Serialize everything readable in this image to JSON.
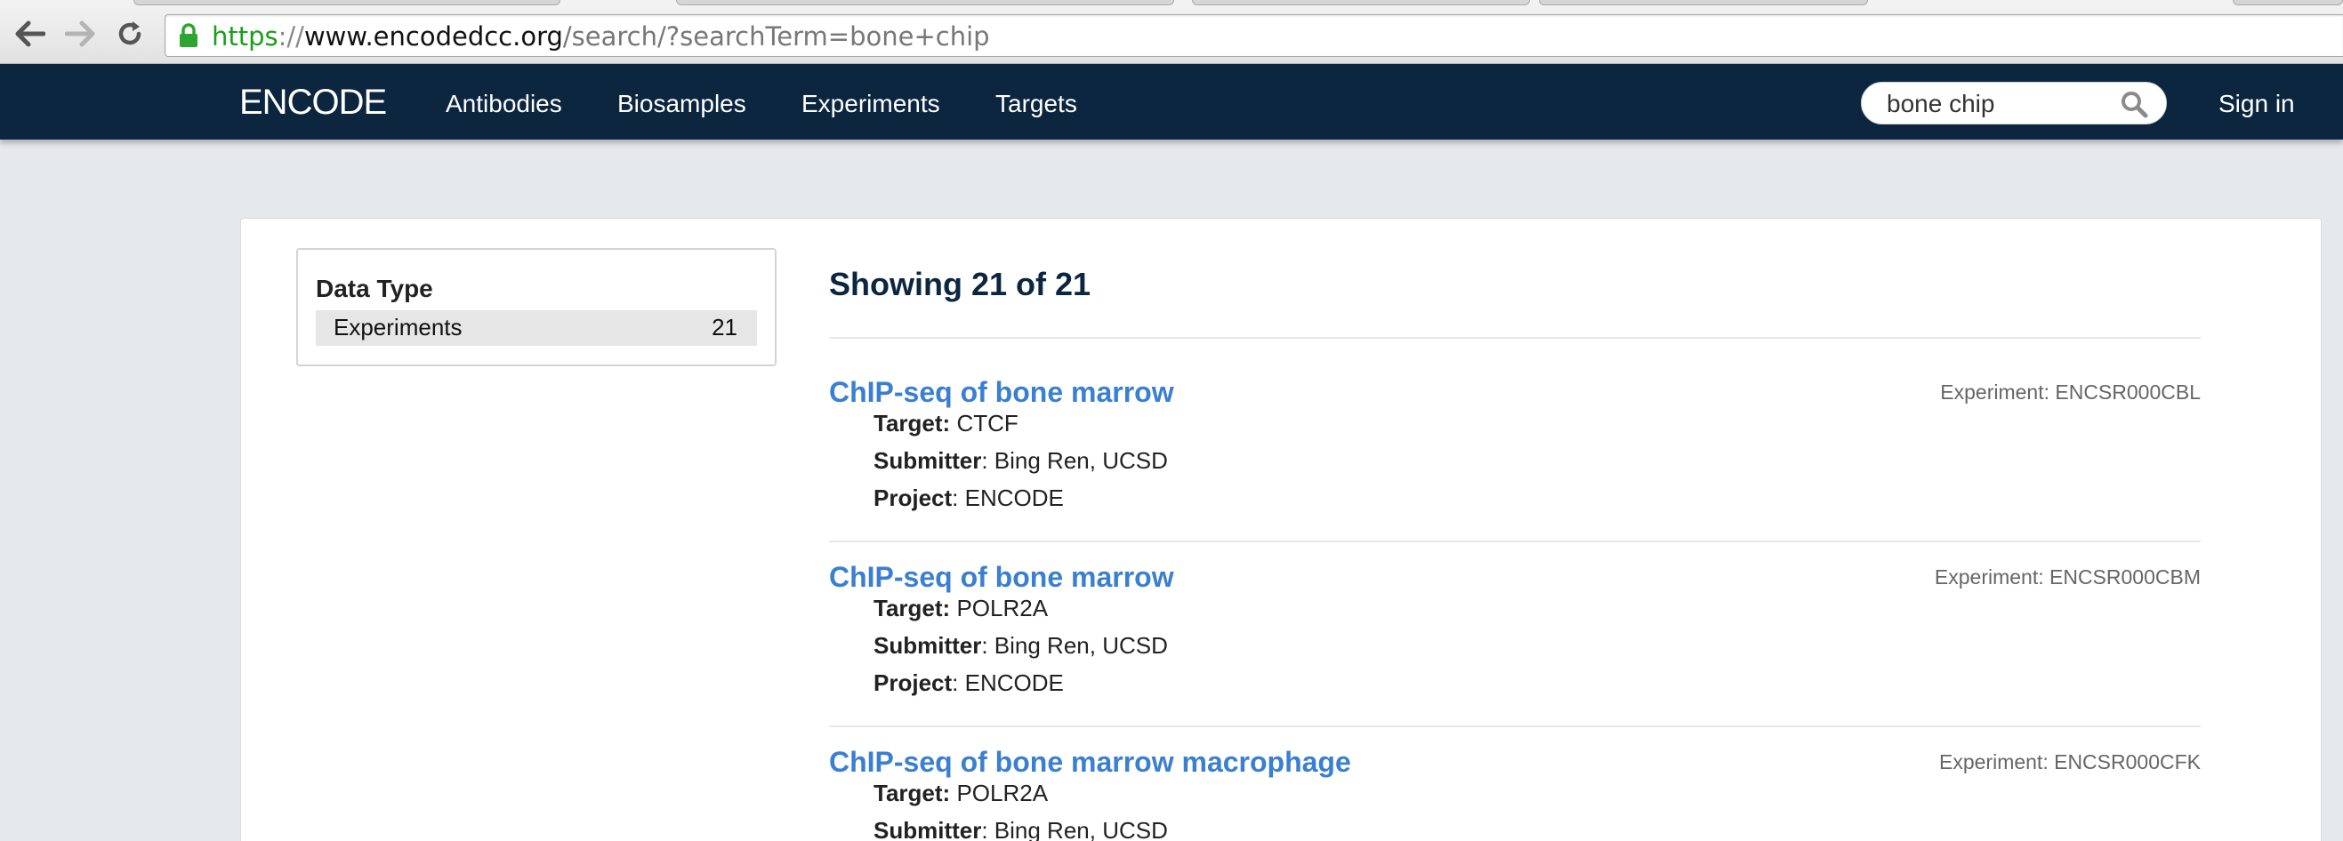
{
  "browser": {
    "url_scheme": "https",
    "url_separator": "://",
    "url_host": "www.encodedcc.org",
    "url_path": "/search/?searchTerm=bone+chip"
  },
  "navbar": {
    "brand": "ENCODE",
    "links": [
      "Antibodies",
      "Biosamples",
      "Experiments",
      "Targets"
    ],
    "search_value": "bone chip",
    "sign_in": "Sign in"
  },
  "facets": {
    "title": "Data Type",
    "terms": [
      {
        "label": "Experiments",
        "count": "21"
      }
    ]
  },
  "results": {
    "heading": "Showing 21 of 21",
    "items": [
      {
        "title": "ChIP-seq of bone marrow",
        "accession": "Experiment: ENCSR000CBL",
        "target_label": "Target:",
        "target": "CTCF",
        "submitter_label": "Submitter",
        "submitter": ": Bing Ren, UCSD",
        "project_label": "Project",
        "project": ": ENCODE"
      },
      {
        "title": "ChIP-seq of bone marrow",
        "accession": "Experiment: ENCSR000CBM",
        "target_label": "Target:",
        "target": "POLR2A",
        "submitter_label": "Submitter",
        "submitter": ": Bing Ren, UCSD",
        "project_label": "Project",
        "project": ": ENCODE"
      },
      {
        "title": "ChIP-seq of bone marrow macrophage",
        "accession": "Experiment: ENCSR000CFK",
        "target_label": "Target:",
        "target": "POLR2A",
        "submitter_label": "Submitter",
        "submitter": ": Bing Ren, UCSD"
      }
    ]
  }
}
